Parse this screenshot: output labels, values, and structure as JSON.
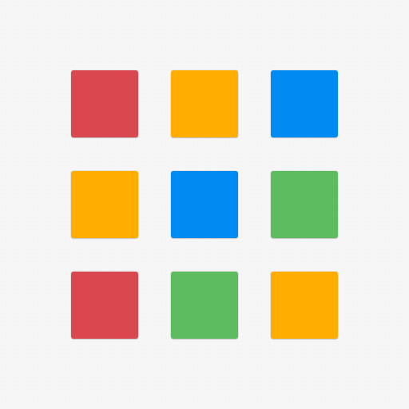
{
  "palette": {
    "red": "#d9474f",
    "yellow": "#ffad00",
    "blue": "#008bf2",
    "green": "#5dbc5f",
    "background": "#f6f6f6"
  },
  "tiles": [
    {
      "name": "tile-red",
      "color": "red"
    },
    {
      "name": "tile-yellow",
      "color": "yellow"
    },
    {
      "name": "tile-blue",
      "color": "blue"
    },
    {
      "name": "tile-yellow",
      "color": "yellow"
    },
    {
      "name": "tile-blue",
      "color": "blue"
    },
    {
      "name": "tile-green",
      "color": "green"
    },
    {
      "name": "tile-red",
      "color": "red"
    },
    {
      "name": "tile-green",
      "color": "green"
    },
    {
      "name": "tile-yellow",
      "color": "yellow"
    }
  ]
}
